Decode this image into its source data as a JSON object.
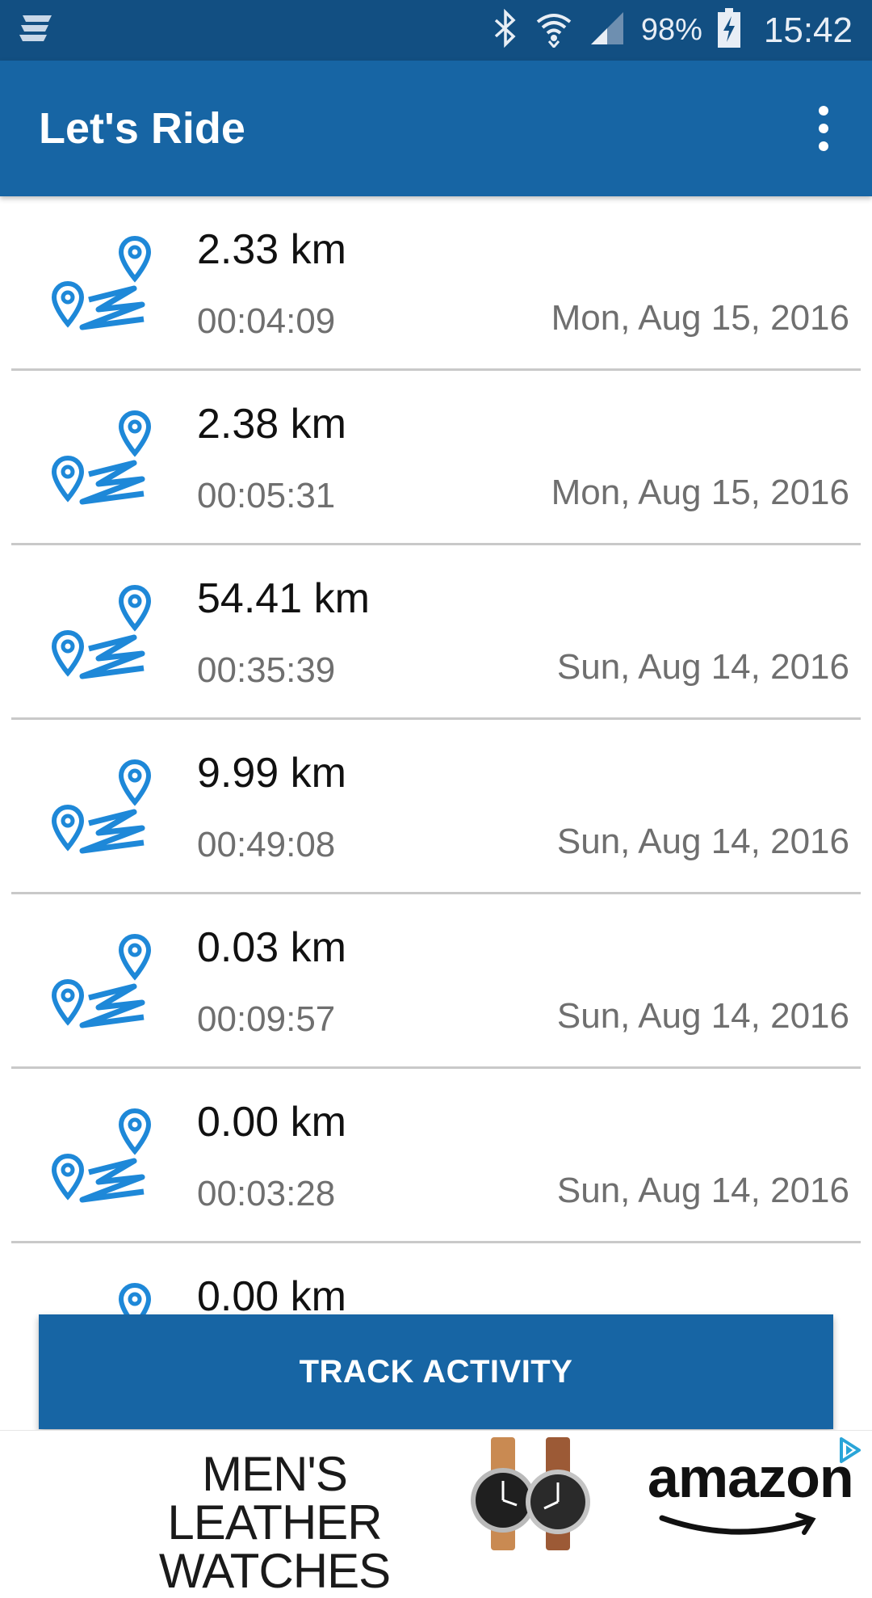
{
  "status_bar": {
    "battery": "98%",
    "time": "15:42"
  },
  "app_bar": {
    "title": "Let's Ride"
  },
  "rides": [
    {
      "distance": "2.33 km",
      "duration": "00:04:09",
      "date": "Mon, Aug 15, 2016"
    },
    {
      "distance": "2.38 km",
      "duration": "00:05:31",
      "date": "Mon, Aug 15, 2016"
    },
    {
      "distance": "54.41 km",
      "duration": "00:35:39",
      "date": "Sun, Aug 14, 2016"
    },
    {
      "distance": "9.99 km",
      "duration": "00:49:08",
      "date": "Sun, Aug 14, 2016"
    },
    {
      "distance": "0.03 km",
      "duration": "00:09:57",
      "date": "Sun, Aug 14, 2016"
    },
    {
      "distance": "0.00 km",
      "duration": "00:03:28",
      "date": "Sun, Aug 14, 2016"
    },
    {
      "distance": "0.00 km",
      "duration": "",
      "date": ""
    }
  ],
  "track_button": {
    "label": "TRACK ACTIVITY"
  },
  "ad": {
    "headline_line1": "MEN'S LEATHER",
    "headline_line2": "WATCHES",
    "brand": "amazon"
  },
  "colors": {
    "status_bar": "#124f82",
    "app_bar": "#1765a4",
    "accent_icon": "#1e88d8"
  }
}
